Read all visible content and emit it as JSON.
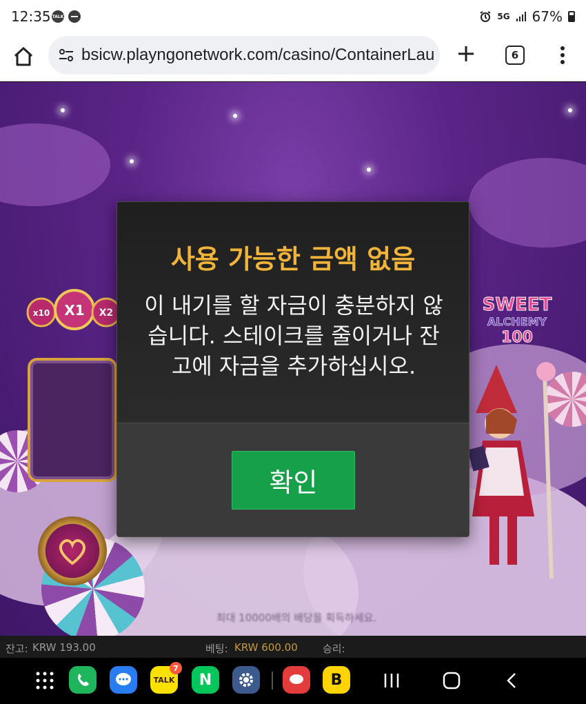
{
  "status_bar": {
    "time": "12:35",
    "network": "5G",
    "battery": "67%"
  },
  "browser": {
    "url": "bsicw.playngonetwork.com/casino/ContainerLau",
    "tab_count": "6"
  },
  "game": {
    "multiplier_low": "x10",
    "multiplier_active": "X1",
    "multiplier_next": "X2",
    "logo_line1": "SWEET",
    "logo_line2": "ALCHEMY",
    "logo_line3": "100",
    "background_hint": "최대 10000배의 배당을 획득하세요."
  },
  "dialog": {
    "title": "사용 가능한 금액 없음",
    "message_line1": "이 내기를 할 자금이 충분하지 않",
    "message_line2": "습니다. 스테이크를 줄이거나 잔",
    "message_line3": "고에 자금을 추가하십시오.",
    "confirm_label": "확인"
  },
  "info_bar": {
    "balance_label": "잔고:",
    "balance_value": "KRW 193.00",
    "bet_label": "베팅:",
    "bet_value": "KRW 600.00",
    "win_label": "승리:"
  },
  "nav": {
    "kakao_badge": "7",
    "talk_label": "TALK",
    "naver_label": "N",
    "b_label": "B"
  },
  "colors": {
    "dialog_title": "#f0b43a",
    "confirm_button": "#16a04a",
    "game_background": "#5a2486"
  }
}
